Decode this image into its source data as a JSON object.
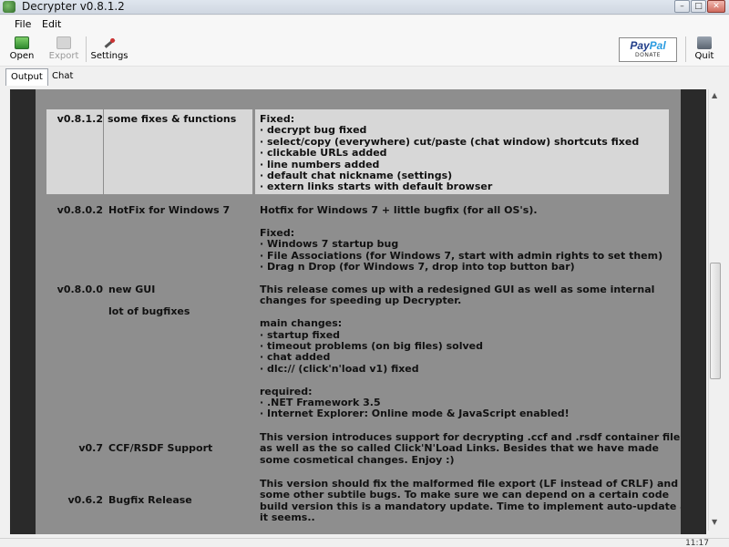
{
  "window": {
    "title": "Decrypter v0.8.1.2",
    "controls": [
      "–",
      "□",
      "✕"
    ]
  },
  "menu": {
    "file": "File",
    "edit": "Edit"
  },
  "toolbar": {
    "open": "Open",
    "export": "Export",
    "settings": "Settings",
    "quit": "Quit",
    "paypal_brand_1": "Pay",
    "paypal_brand_2": "Pal",
    "paypal_sub": "DONATE"
  },
  "tabs": [
    {
      "label": "Output",
      "active": true
    },
    {
      "label": "Chat",
      "active": false
    }
  ],
  "changelog": [
    {
      "version": "v0.8.1.2",
      "title": [
        "some fixes & functions"
      ],
      "desc": [
        "Fixed:",
        "· decrypt bug fixed",
        "· select/copy (everywhere) cut/paste (chat window) shortcuts fixed",
        "· clickable URLs added",
        "· line numbers added",
        "· default chat nickname (settings)",
        "· extern links starts with default browser"
      ]
    },
    {
      "version": "v0.8.0.2",
      "title": [
        "HotFix for Windows 7"
      ],
      "desc": [
        "Hotfix for Windows 7 + little bugfix (for all OS's).",
        "",
        "Fixed:",
        "· Windows 7 startup bug",
        "· File Associations (for Windows 7, start with admin rights to set them)",
        "· Drag n Drop (for Windows 7, drop into top button bar)"
      ]
    },
    {
      "version": "v0.8.0.0",
      "title": [
        "new GUI",
        "lot of bugfixes"
      ],
      "desc": [
        "This release comes up with a redesigned GUI as well as some internal",
        "changes for speeding up Decrypter.",
        "",
        "main changes:",
        "· startup fixed",
        "· timeout problems (on big files) solved",
        "· chat added",
        "· dlc:// (click'n'load v1) fixed",
        "",
        "required:",
        "· .NET Framework 3.5",
        "· Internet Explorer: Online mode & JavaScript enabled!"
      ]
    },
    {
      "version": "v0.7",
      "title": [
        "CCF/RSDF Support"
      ],
      "desc": [
        "This version introduces support for decrypting .ccf and .rsdf container files",
        "as well as the so called Click'N'Load Links. Besides that we have made",
        "some cosmetical changes. Enjoy :)"
      ]
    },
    {
      "version": "v0.6.2",
      "title": [
        "Bugfix Release"
      ],
      "desc": [
        "This version should fix the malformed file export (LF instead of CRLF) and",
        "some other subtile bugs. To make sure we can depend on a certain code",
        "build version this is a mandatory update. Time to implement auto-update as",
        "it seems.."
      ]
    }
  ],
  "statusbar": {
    "clock": "11:17"
  }
}
